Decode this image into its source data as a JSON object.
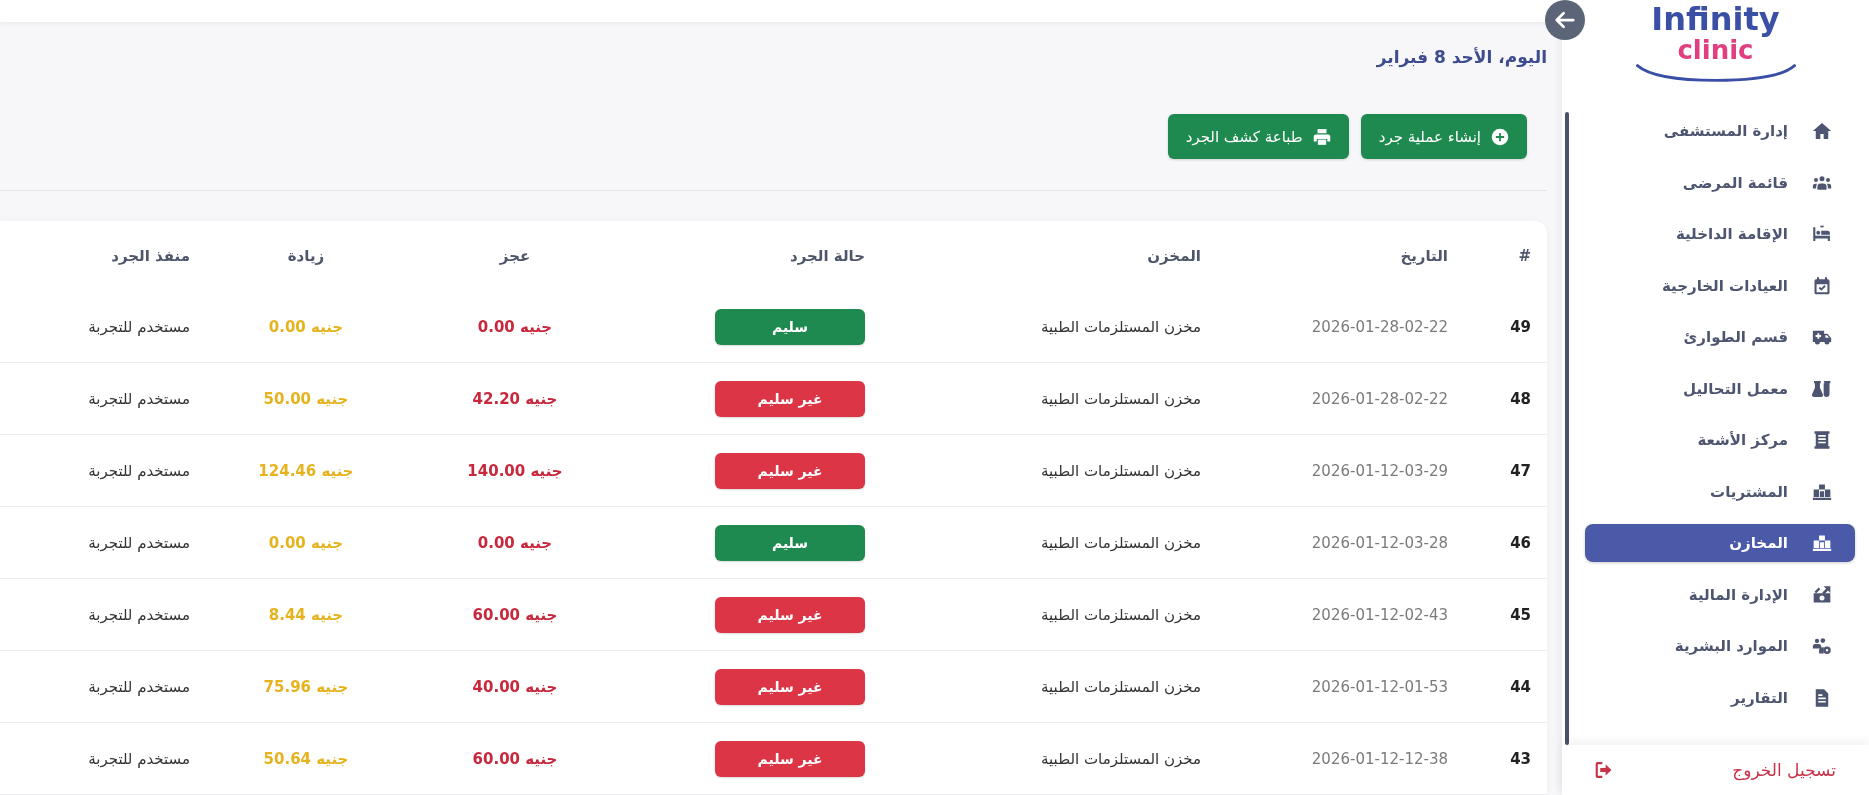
{
  "sidebar": {
    "logo": {
      "name": "Infinity",
      "tagline": "clinic"
    },
    "items": [
      {
        "label": "إدارة المستشفى",
        "selected": false
      },
      {
        "label": "قائمة المرضى",
        "selected": false
      },
      {
        "label": "الإقامة الداخلية",
        "selected": false
      },
      {
        "label": "العيادات الخارجية",
        "selected": false
      },
      {
        "label": "قسم الطوارئ",
        "selected": false
      },
      {
        "label": "معمل التحاليل",
        "selected": false
      },
      {
        "label": "مركز الأشعة",
        "selected": false
      },
      {
        "label": "المشتريات",
        "selected": false
      },
      {
        "label": "المخازن",
        "selected": true
      },
      {
        "label": "الإدارة المالية",
        "selected": false
      },
      {
        "label": "الموارد البشرية",
        "selected": false
      },
      {
        "label": "التقارير",
        "selected": false
      }
    ],
    "logout": "تسجيل الخروج"
  },
  "header": {
    "date": "اليوم، الأحد 8 فبراير"
  },
  "toolbar": {
    "buttons": [
      "إنشاء عملية جرد",
      "طباعة كشف الجرد"
    ]
  },
  "table": {
    "columns": [
      "#",
      "التاريخ",
      "المخزن",
      "حالة الجرد",
      "عجز",
      "زيادة",
      "منفذ الجرد"
    ],
    "rows": [
      {
        "number": "49",
        "date": "2026-01-28-02-22",
        "store": "مخزن المستلزمات الطبية",
        "status": {
          "label": "سليم",
          "color": "#1e8a4f"
        },
        "shortage": "0.00 جنيه",
        "surplus": "0.00 جنيه",
        "executor": "مستخدم للتجربة"
      },
      {
        "number": "48",
        "date": "2026-01-28-02-22",
        "store": "مخزن المستلزمات الطبية",
        "status": {
          "label": "غير سليم",
          "color": "#dc3545"
        },
        "shortage": "42.20 جنيه",
        "surplus": "50.00 جنيه",
        "executor": "مستخدم للتجربة"
      },
      {
        "number": "47",
        "date": "2026-01-12-03-29",
        "store": "مخزن المستلزمات الطبية",
        "status": {
          "label": "غير سليم",
          "color": "#dc3545"
        },
        "shortage": "140.00 جنيه",
        "surplus": "124.46 جنيه",
        "executor": "مستخدم للتجربة"
      },
      {
        "number": "46",
        "date": "2026-01-12-03-28",
        "store": "مخزن المستلزمات الطبية",
        "status": {
          "label": "سليم",
          "color": "#1e8a4f"
        },
        "shortage": "0.00 جنيه",
        "surplus": "0.00 جنيه",
        "executor": "مستخدم للتجربة"
      },
      {
        "number": "45",
        "date": "2026-01-12-02-43",
        "store": "مخزن المستلزمات الطبية",
        "status": {
          "label": "غير سليم",
          "color": "#dc3545"
        },
        "shortage": "60.00 جنيه",
        "surplus": "8.44 جنيه",
        "executor": "مستخدم للتجربة"
      },
      {
        "number": "44",
        "date": "2026-01-12-01-53",
        "store": "مخزن المستلزمات الطبية",
        "status": {
          "label": "غير سليم",
          "color": "#dc3545"
        },
        "shortage": "40.00 جنيه",
        "surplus": "75.96 جنيه",
        "executor": "مستخدم للتجربة"
      },
      {
        "number": "43",
        "date": "2026-01-12-12-38",
        "store": "مخزن المستلزمات الطبية",
        "status": {
          "label": "غير سليم",
          "color": "#dc3545"
        },
        "shortage": "60.00 جنيه",
        "surplus": "50.64 جنيه",
        "executor": "مستخدم للتجربة"
      }
    ]
  }
}
